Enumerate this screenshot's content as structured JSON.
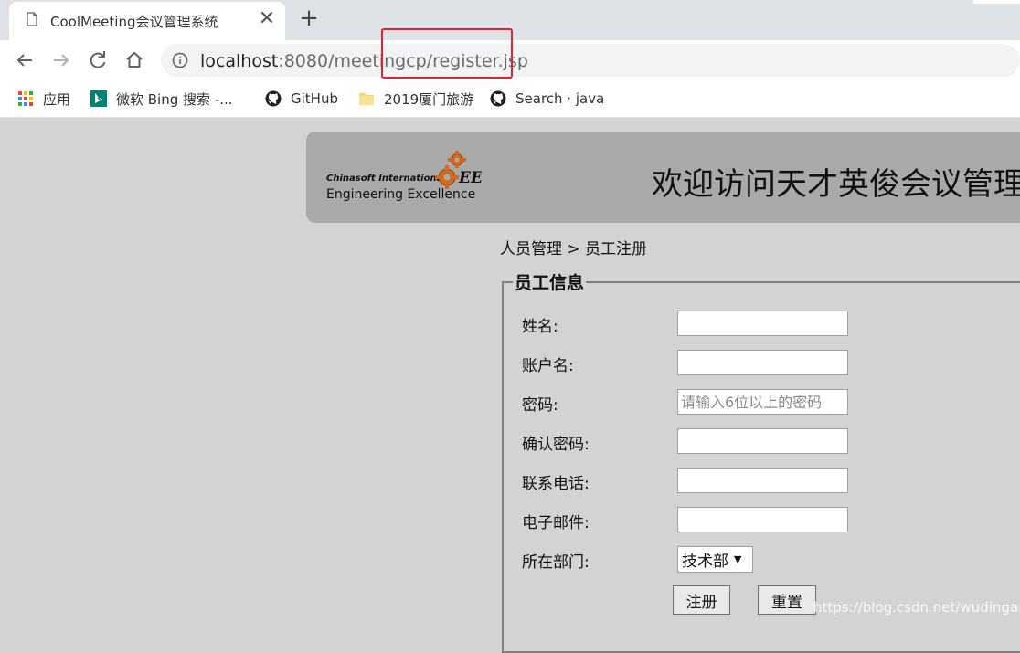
{
  "browser": {
    "tab_title": "CoolMeeting会议管理系统",
    "tab_close": "✕",
    "new_tab": "+",
    "url_host": "localhost",
    "url_path": ":8080/meetingcp/register.jsp",
    "bookmarks": [
      {
        "label": "应用",
        "icon": "apps-grid-icon"
      },
      {
        "label": "微软 Bing 搜索 -...",
        "icon": "bing-icon"
      },
      {
        "label": "GitHub",
        "icon": "github-icon"
      },
      {
        "label": "2019厦门旅游",
        "icon": "folder-icon"
      },
      {
        "label": "Search · java",
        "icon": "github-icon"
      }
    ]
  },
  "header": {
    "logo_line1": "Chinasoft International",
    "logo_line2": "Engineering Excellence",
    "logo_mark": "EE",
    "title": "欢迎访问天才英俊会议管理"
  },
  "breadcrumb": "人员管理 > 员工注册",
  "form": {
    "legend": "员工信息",
    "fields": [
      {
        "label": "姓名:",
        "value": "",
        "placeholder": ""
      },
      {
        "label": "账户名:",
        "value": "",
        "placeholder": ""
      },
      {
        "label": "密码:",
        "value": "",
        "placeholder": "请输入6位以上的密码"
      },
      {
        "label": "确认密码:",
        "value": "",
        "placeholder": ""
      },
      {
        "label": "联系电话:",
        "value": "",
        "placeholder": ""
      },
      {
        "label": "电子邮件:",
        "value": "",
        "placeholder": ""
      }
    ],
    "department_label": "所在部门:",
    "department_selected": "技术部",
    "register_button": "注册",
    "reset_button": "重置"
  },
  "watermark": "https://blog.csdn.net/wudingan",
  "colors": {
    "page_bg": "#d3d3d3",
    "banner_bg": "#a9a9a9",
    "annotation_red": "#e8202a"
  }
}
